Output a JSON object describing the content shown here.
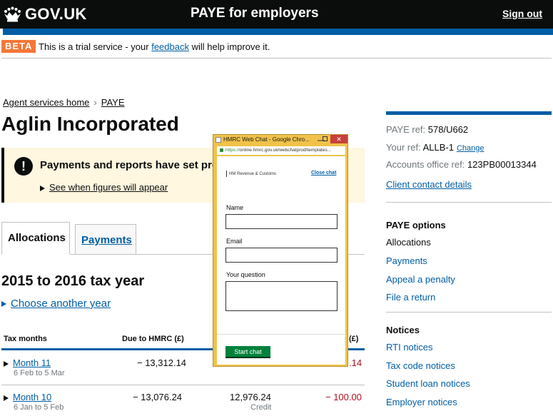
{
  "header": {
    "logo": "GOV.UK",
    "service_name": "PAYE for employers",
    "sign_out": "Sign out"
  },
  "beta": {
    "tag": "BETA",
    "text_before": "This is a trial service - your ",
    "link": "feedback",
    "text_after": " will help improve it."
  },
  "breadcrumbs": [
    "Agent services home",
    "PAYE"
  ],
  "page_title": "Aglin Incorporated",
  "notice": {
    "title": "Payments and reports have set proc",
    "details": "See when figures will appear"
  },
  "tabs": [
    {
      "label": "Allocations"
    },
    {
      "label": "Payments"
    }
  ],
  "tax_year": "2015 to 2016 tax year",
  "choose_year": "Choose another year",
  "table": {
    "headers": [
      "Tax months",
      "Due to HMRC (£)",
      "(£)"
    ],
    "rows": [
      {
        "month": "Month 11",
        "range": "6 Feb to 5 Mar",
        "due": "− 13,312.14",
        "paid": "",
        "paid_sub": "",
        "balance": ".14"
      },
      {
        "month": "Month 10",
        "range": "6 Jan to 5 Feb",
        "due": "− 13,076.24",
        "paid": "12,976.24",
        "paid_sub": "Credit",
        "balance": "− 100.00"
      }
    ]
  },
  "sidebar": {
    "paye_ref_label": "PAYE ref:",
    "paye_ref": "578/U662",
    "your_ref_label": "Your ref:",
    "your_ref": "ALLB-1",
    "change": "Change",
    "office_ref_label": "Accounts office ref:",
    "office_ref": "123PB00013344",
    "contact": "Client contact details",
    "options_heading": "PAYE options",
    "options": [
      "Allocations",
      "Payments",
      "Appeal a penalty",
      "File a return"
    ],
    "notices_heading": "Notices",
    "notices": [
      "RTI notices",
      "Tax code notices",
      "Student loan notices",
      "Employer notices"
    ]
  },
  "popup": {
    "window_title": "HMRC Web Chat - Google Chro...",
    "url_prefix": "https://",
    "url": "online.hmrc.gov.uk/webchatprod/templates...",
    "brand": "HM Revenue & Customs",
    "close_chat": "Close chat",
    "name_label": "Name",
    "email_label": "Email",
    "question_label": "Your question",
    "start_button": "Start chat"
  },
  "colors": {
    "header": "#0b0c0c",
    "brand_blue": "#005ea5",
    "beta": "#f47738",
    "popup_frame": "#f0c24a",
    "start_button": "#00823b",
    "negative": "#b10e1e"
  }
}
